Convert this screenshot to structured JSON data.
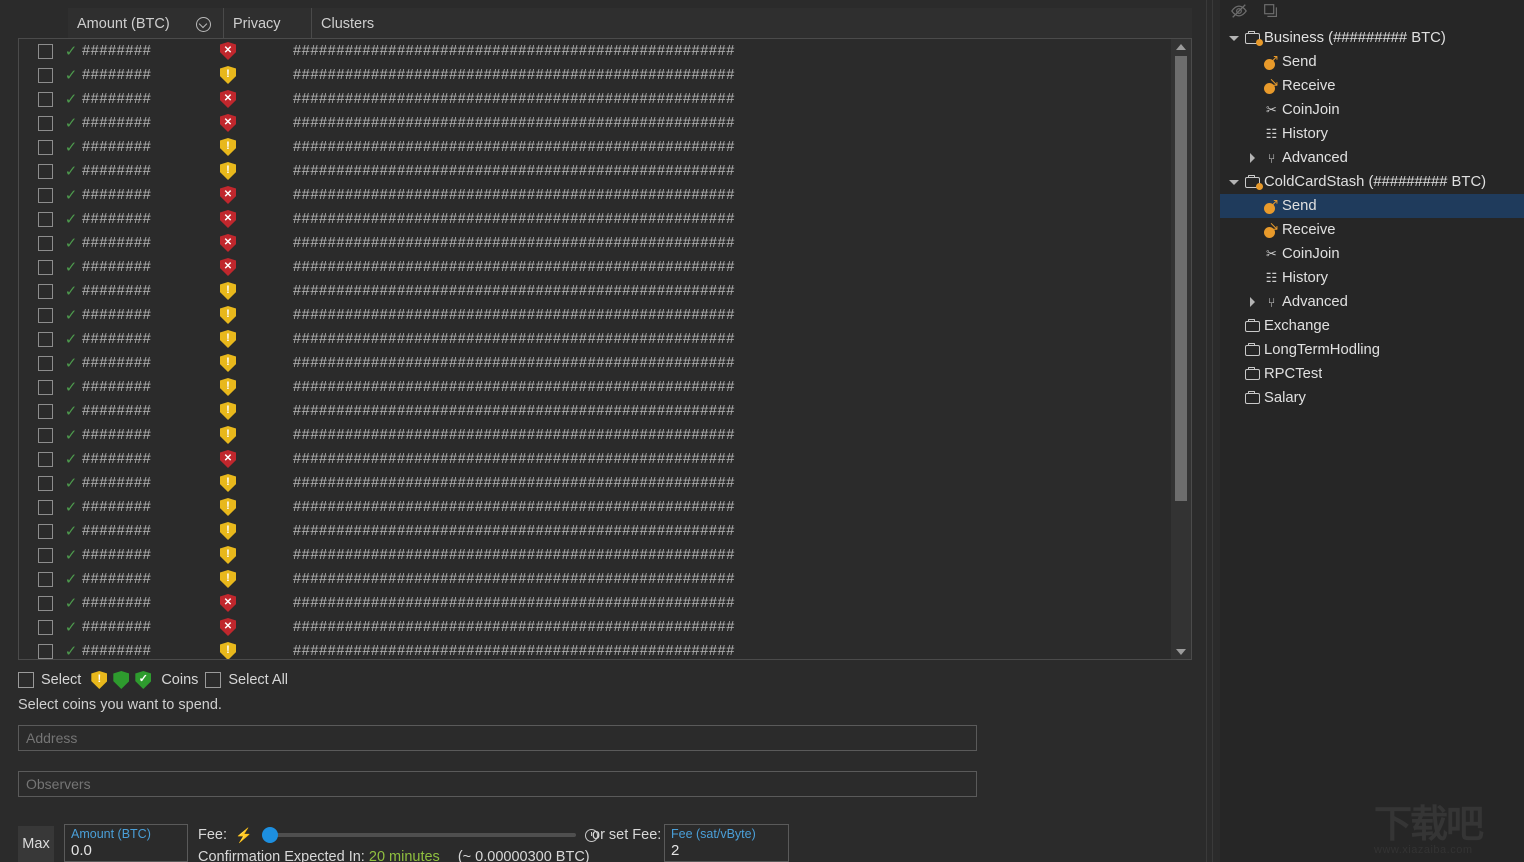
{
  "table": {
    "columns": [
      {
        "key": "amount",
        "label": "Amount (BTC)",
        "sort_icon": "sort-circle-chevron-down-icon"
      },
      {
        "key": "privacy",
        "label": "Privacy"
      },
      {
        "key": "clusters",
        "label": "Clusters"
      }
    ],
    "masked_amount": "########",
    "masked_cluster": "###################################################",
    "rows": [
      {
        "selected": false,
        "confirmed": true,
        "privacy": "red"
      },
      {
        "selected": false,
        "confirmed": true,
        "privacy": "yellow"
      },
      {
        "selected": false,
        "confirmed": true,
        "privacy": "red"
      },
      {
        "selected": false,
        "confirmed": true,
        "privacy": "red"
      },
      {
        "selected": false,
        "confirmed": true,
        "privacy": "yellow"
      },
      {
        "selected": false,
        "confirmed": true,
        "privacy": "yellow"
      },
      {
        "selected": false,
        "confirmed": true,
        "privacy": "red"
      },
      {
        "selected": false,
        "confirmed": true,
        "privacy": "red"
      },
      {
        "selected": false,
        "confirmed": true,
        "privacy": "red"
      },
      {
        "selected": false,
        "confirmed": true,
        "privacy": "red"
      },
      {
        "selected": false,
        "confirmed": true,
        "privacy": "yellow"
      },
      {
        "selected": false,
        "confirmed": true,
        "privacy": "yellow"
      },
      {
        "selected": false,
        "confirmed": true,
        "privacy": "yellow"
      },
      {
        "selected": false,
        "confirmed": true,
        "privacy": "yellow"
      },
      {
        "selected": false,
        "confirmed": true,
        "privacy": "yellow"
      },
      {
        "selected": false,
        "confirmed": true,
        "privacy": "yellow"
      },
      {
        "selected": false,
        "confirmed": true,
        "privacy": "yellow"
      },
      {
        "selected": false,
        "confirmed": true,
        "privacy": "red"
      },
      {
        "selected": false,
        "confirmed": true,
        "privacy": "yellow"
      },
      {
        "selected": false,
        "confirmed": true,
        "privacy": "yellow"
      },
      {
        "selected": false,
        "confirmed": true,
        "privacy": "yellow"
      },
      {
        "selected": false,
        "confirmed": true,
        "privacy": "yellow"
      },
      {
        "selected": false,
        "confirmed": true,
        "privacy": "yellow"
      },
      {
        "selected": false,
        "confirmed": true,
        "privacy": "red"
      },
      {
        "selected": false,
        "confirmed": true,
        "privacy": "red"
      },
      {
        "selected": false,
        "confirmed": true,
        "privacy": "yellow"
      }
    ]
  },
  "select_controls": {
    "select_label": "Select",
    "coins_label": "Coins",
    "select_all_label": "Select All",
    "shields": [
      "yellow",
      "green",
      "green-check"
    ],
    "select_checked": false,
    "select_all_checked": false
  },
  "hint": "Select coins you want to spend.",
  "address_field": {
    "placeholder": "Address",
    "value": ""
  },
  "observers_field": {
    "placeholder": "Observers",
    "value": ""
  },
  "bottom_bar": {
    "max_label": "Max",
    "amount": {
      "caption": "Amount (BTC)",
      "value": "0.0"
    },
    "fee_label": "Fee:",
    "slider_percent": 0,
    "confirmation_prefix": "Confirmation Expected In:",
    "confirmation_time": "20 minutes",
    "confirmation_btc": "(~ 0.00000300 BTC)",
    "or_set_fee_label": "or set Fee:",
    "fee": {
      "caption": "Fee (sat/vByte)",
      "value": "2"
    }
  },
  "sidebar": {
    "toolbar": [
      {
        "icon": "eye-off-icon"
      },
      {
        "icon": "copy-layers-icon"
      }
    ],
    "tree": [
      {
        "label": "Business (######### BTC)",
        "icon": "wallet-icon",
        "indent": 0,
        "expander": "expanded",
        "selected": false
      },
      {
        "label": "Send",
        "icon": "send-icon",
        "indent": 1,
        "expander": "none",
        "selected": false
      },
      {
        "label": "Receive",
        "icon": "receive-icon",
        "indent": 1,
        "expander": "none",
        "selected": false
      },
      {
        "label": "CoinJoin",
        "icon": "coinjoin-icon",
        "indent": 1,
        "expander": "none",
        "selected": false
      },
      {
        "label": "History",
        "icon": "history-icon",
        "indent": 1,
        "expander": "none",
        "selected": false
      },
      {
        "label": "Advanced",
        "icon": "advanced-icon",
        "indent": 1,
        "expander": "collapsed",
        "selected": false
      },
      {
        "label": "ColdCardStash (######### BTC)",
        "icon": "wallet-icon",
        "indent": 0,
        "expander": "expanded",
        "selected": false
      },
      {
        "label": "Send",
        "icon": "send-icon",
        "indent": 1,
        "expander": "none",
        "selected": true
      },
      {
        "label": "Receive",
        "icon": "receive-icon",
        "indent": 1,
        "expander": "none",
        "selected": false
      },
      {
        "label": "CoinJoin",
        "icon": "coinjoin-icon",
        "indent": 1,
        "expander": "none",
        "selected": false
      },
      {
        "label": "History",
        "icon": "history-icon",
        "indent": 1,
        "expander": "none",
        "selected": false
      },
      {
        "label": "Advanced",
        "icon": "advanced-icon",
        "indent": 1,
        "expander": "collapsed",
        "selected": false
      },
      {
        "label": "Exchange",
        "icon": "wallet-plain-icon",
        "indent": 0,
        "expander": "none",
        "selected": false
      },
      {
        "label": "LongTermHodling",
        "icon": "wallet-plain-icon",
        "indent": 0,
        "expander": "none",
        "selected": false
      },
      {
        "label": "RPCTest",
        "icon": "wallet-plain-icon",
        "indent": 0,
        "expander": "none",
        "selected": false
      },
      {
        "label": "Salary",
        "icon": "wallet-plain-icon",
        "indent": 0,
        "expander": "none",
        "selected": false
      }
    ]
  },
  "watermark": {
    "text": "下载吧",
    "url": "www.xiazaiba.com"
  },
  "colors": {
    "background": "#262626",
    "panel": "#2b2b2b",
    "header": "#2f2f2f",
    "selection": "#1f3b5c",
    "accent_orange": "#e89a2b",
    "accent_blue": "#4a9fd8",
    "privacy_red": "#c0272d",
    "privacy_yellow": "#e8b81c",
    "privacy_green": "#2e9b2e",
    "confirm_green": "#8fbf3f"
  }
}
